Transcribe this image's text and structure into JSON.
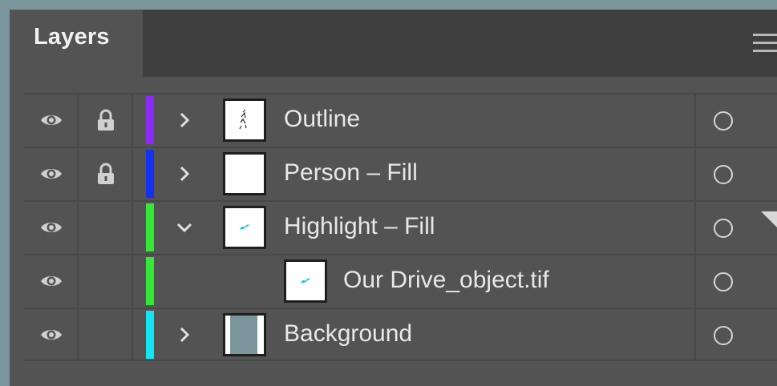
{
  "panel": {
    "tab_label": "Layers"
  },
  "layers": [
    {
      "name": "Outline",
      "color": "#8b2cf5",
      "locked": true,
      "expanded": false,
      "thumb": "outline-sketch"
    },
    {
      "name": "Person – Fill",
      "color": "#1431f0",
      "locked": true,
      "expanded": false,
      "thumb": "blank"
    },
    {
      "name": "Highlight – Fill",
      "color": "#36e838",
      "locked": false,
      "expanded": true,
      "thumb": "cyan-mark"
    },
    {
      "name": "Our Drive_object.tif",
      "color": "#36e838",
      "locked": false,
      "child": true,
      "thumb": "cyan-mark"
    },
    {
      "name": "Background",
      "color": "#12e4f4",
      "locked": false,
      "expanded": false,
      "thumb": "slate-fill"
    }
  ],
  "icons": {
    "visibility": "eye-icon",
    "lock": "lock-icon",
    "expand": "chevron-right-icon",
    "collapse": "chevron-down-icon",
    "target": "target-circle-icon",
    "menu": "hamburger-menu-icon"
  },
  "colors": {
    "panel_bg": "#535353",
    "header_bg": "#3f3f3f",
    "window_bg": "#7a959b"
  }
}
